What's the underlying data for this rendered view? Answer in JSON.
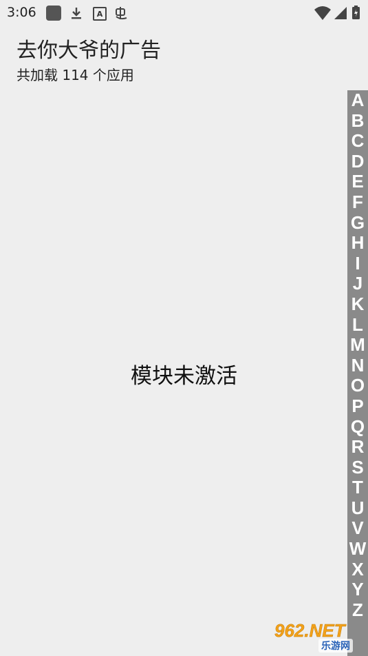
{
  "status_bar": {
    "time": "3:06",
    "icons": [
      "square-app-icon",
      "download-icon",
      "a-icon",
      "bug-icon",
      "wifi-icon",
      "signal-icon",
      "battery-icon"
    ],
    "a_icon_letter": "A"
  },
  "header": {
    "title": "去你大爷的广告",
    "subtitle": "共加载 114 个应用"
  },
  "main": {
    "empty_message": "模块未激活"
  },
  "alpha_index": {
    "letters": [
      "A",
      "B",
      "C",
      "D",
      "E",
      "F",
      "G",
      "H",
      "I",
      "J",
      "K",
      "L",
      "M",
      "N",
      "O",
      "P",
      "Q",
      "R",
      "S",
      "T",
      "U",
      "V",
      "W",
      "X",
      "Y",
      "Z"
    ]
  },
  "watermark": {
    "main": "962.NET",
    "sub": "乐游网"
  },
  "colors": {
    "background": "#eeeeee",
    "index_bar": "#8a8a8a",
    "index_text": "#ffffff"
  }
}
